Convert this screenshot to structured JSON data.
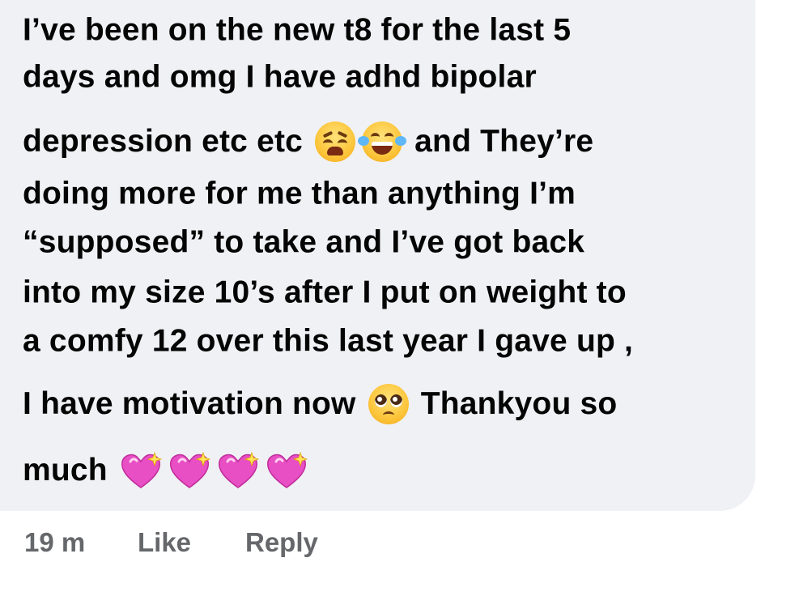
{
  "comment": {
    "line1": "I’ve been on the new t8 for the last 5",
    "line2": "days and omg I have adhd bipolar",
    "line3a": "depression etc etc",
    "line3b": "and They’re",
    "line4": "doing more for me than anything I’m",
    "line5": "“supposed” to take and I’ve got back",
    "line6": "into my size 10’s after I put on weight to",
    "line7": "a comfy 12 over this last year I gave up ,",
    "line8a": "I  have motivation now",
    "line8b": "Thankyou so",
    "line9": "much",
    "emojis": {
      "line3": [
        "weary-face-emoji",
        "face-with-tears-of-joy-emoji"
      ],
      "line8": [
        "pleading-face-emoji"
      ],
      "line9": [
        "sparkling-heart-emoji",
        "sparkling-heart-emoji",
        "sparkling-heart-emoji",
        "sparkling-heart-emoji"
      ]
    }
  },
  "actions": {
    "time": "19 m",
    "like": "Like",
    "reply": "Reply"
  },
  "colors": {
    "bubble": "#f0f1f5",
    "text": "#050505",
    "meta": "#65676b",
    "heart": "#e84fc4"
  }
}
